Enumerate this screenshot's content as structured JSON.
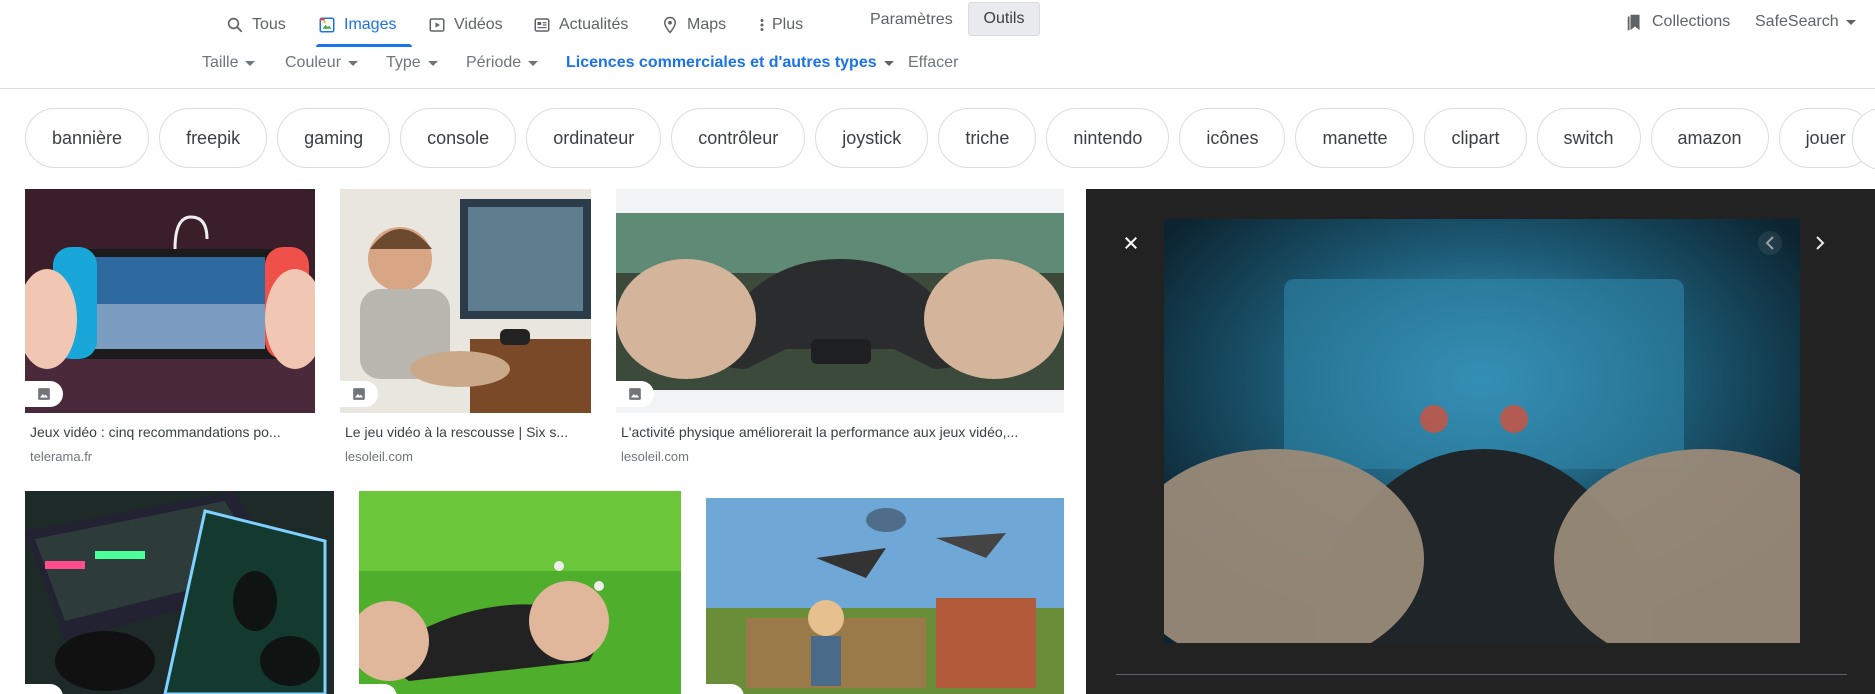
{
  "nav": {
    "tabs": [
      {
        "label": "Tous",
        "icon": "search-icon"
      },
      {
        "label": "Images",
        "icon": "image-icon",
        "active": true
      },
      {
        "label": "Vidéos",
        "icon": "video-icon"
      },
      {
        "label": "Actualités",
        "icon": "news-icon"
      },
      {
        "label": "Maps",
        "icon": "map-pin-icon"
      },
      {
        "label": "Plus",
        "icon": "more-vert-icon"
      }
    ],
    "parametres": "Paramètres",
    "outils": "Outils",
    "collections": "Collections",
    "safesearch": "SafeSearch"
  },
  "tools": {
    "taille": "Taille",
    "couleur": "Couleur",
    "type": "Type",
    "periode": "Période",
    "licences": "Licences commerciales et d'autres types",
    "effacer": "Effacer"
  },
  "chips": [
    "bannière",
    "freepik",
    "gaming",
    "console",
    "ordinateur",
    "contrôleur",
    "joystick",
    "triche",
    "nintendo",
    "icônes",
    "manette",
    "clipart",
    "switch",
    "amazon",
    "jouer"
  ],
  "results": [
    {
      "caption": "Jeux vidéo : cinq recommandations po...",
      "source": "telerama.fr"
    },
    {
      "caption": "Le jeu vidéo à la rescousse | Six s...",
      "source": "lesoleil.com"
    },
    {
      "caption": "L'activité physique améliorerait la performance aux jeux vidéo,...",
      "source": "lesoleil.com"
    }
  ],
  "colors": {
    "accent": "#1a73e8",
    "preview_bg": "#222222",
    "chip_border": "#dadce0"
  }
}
